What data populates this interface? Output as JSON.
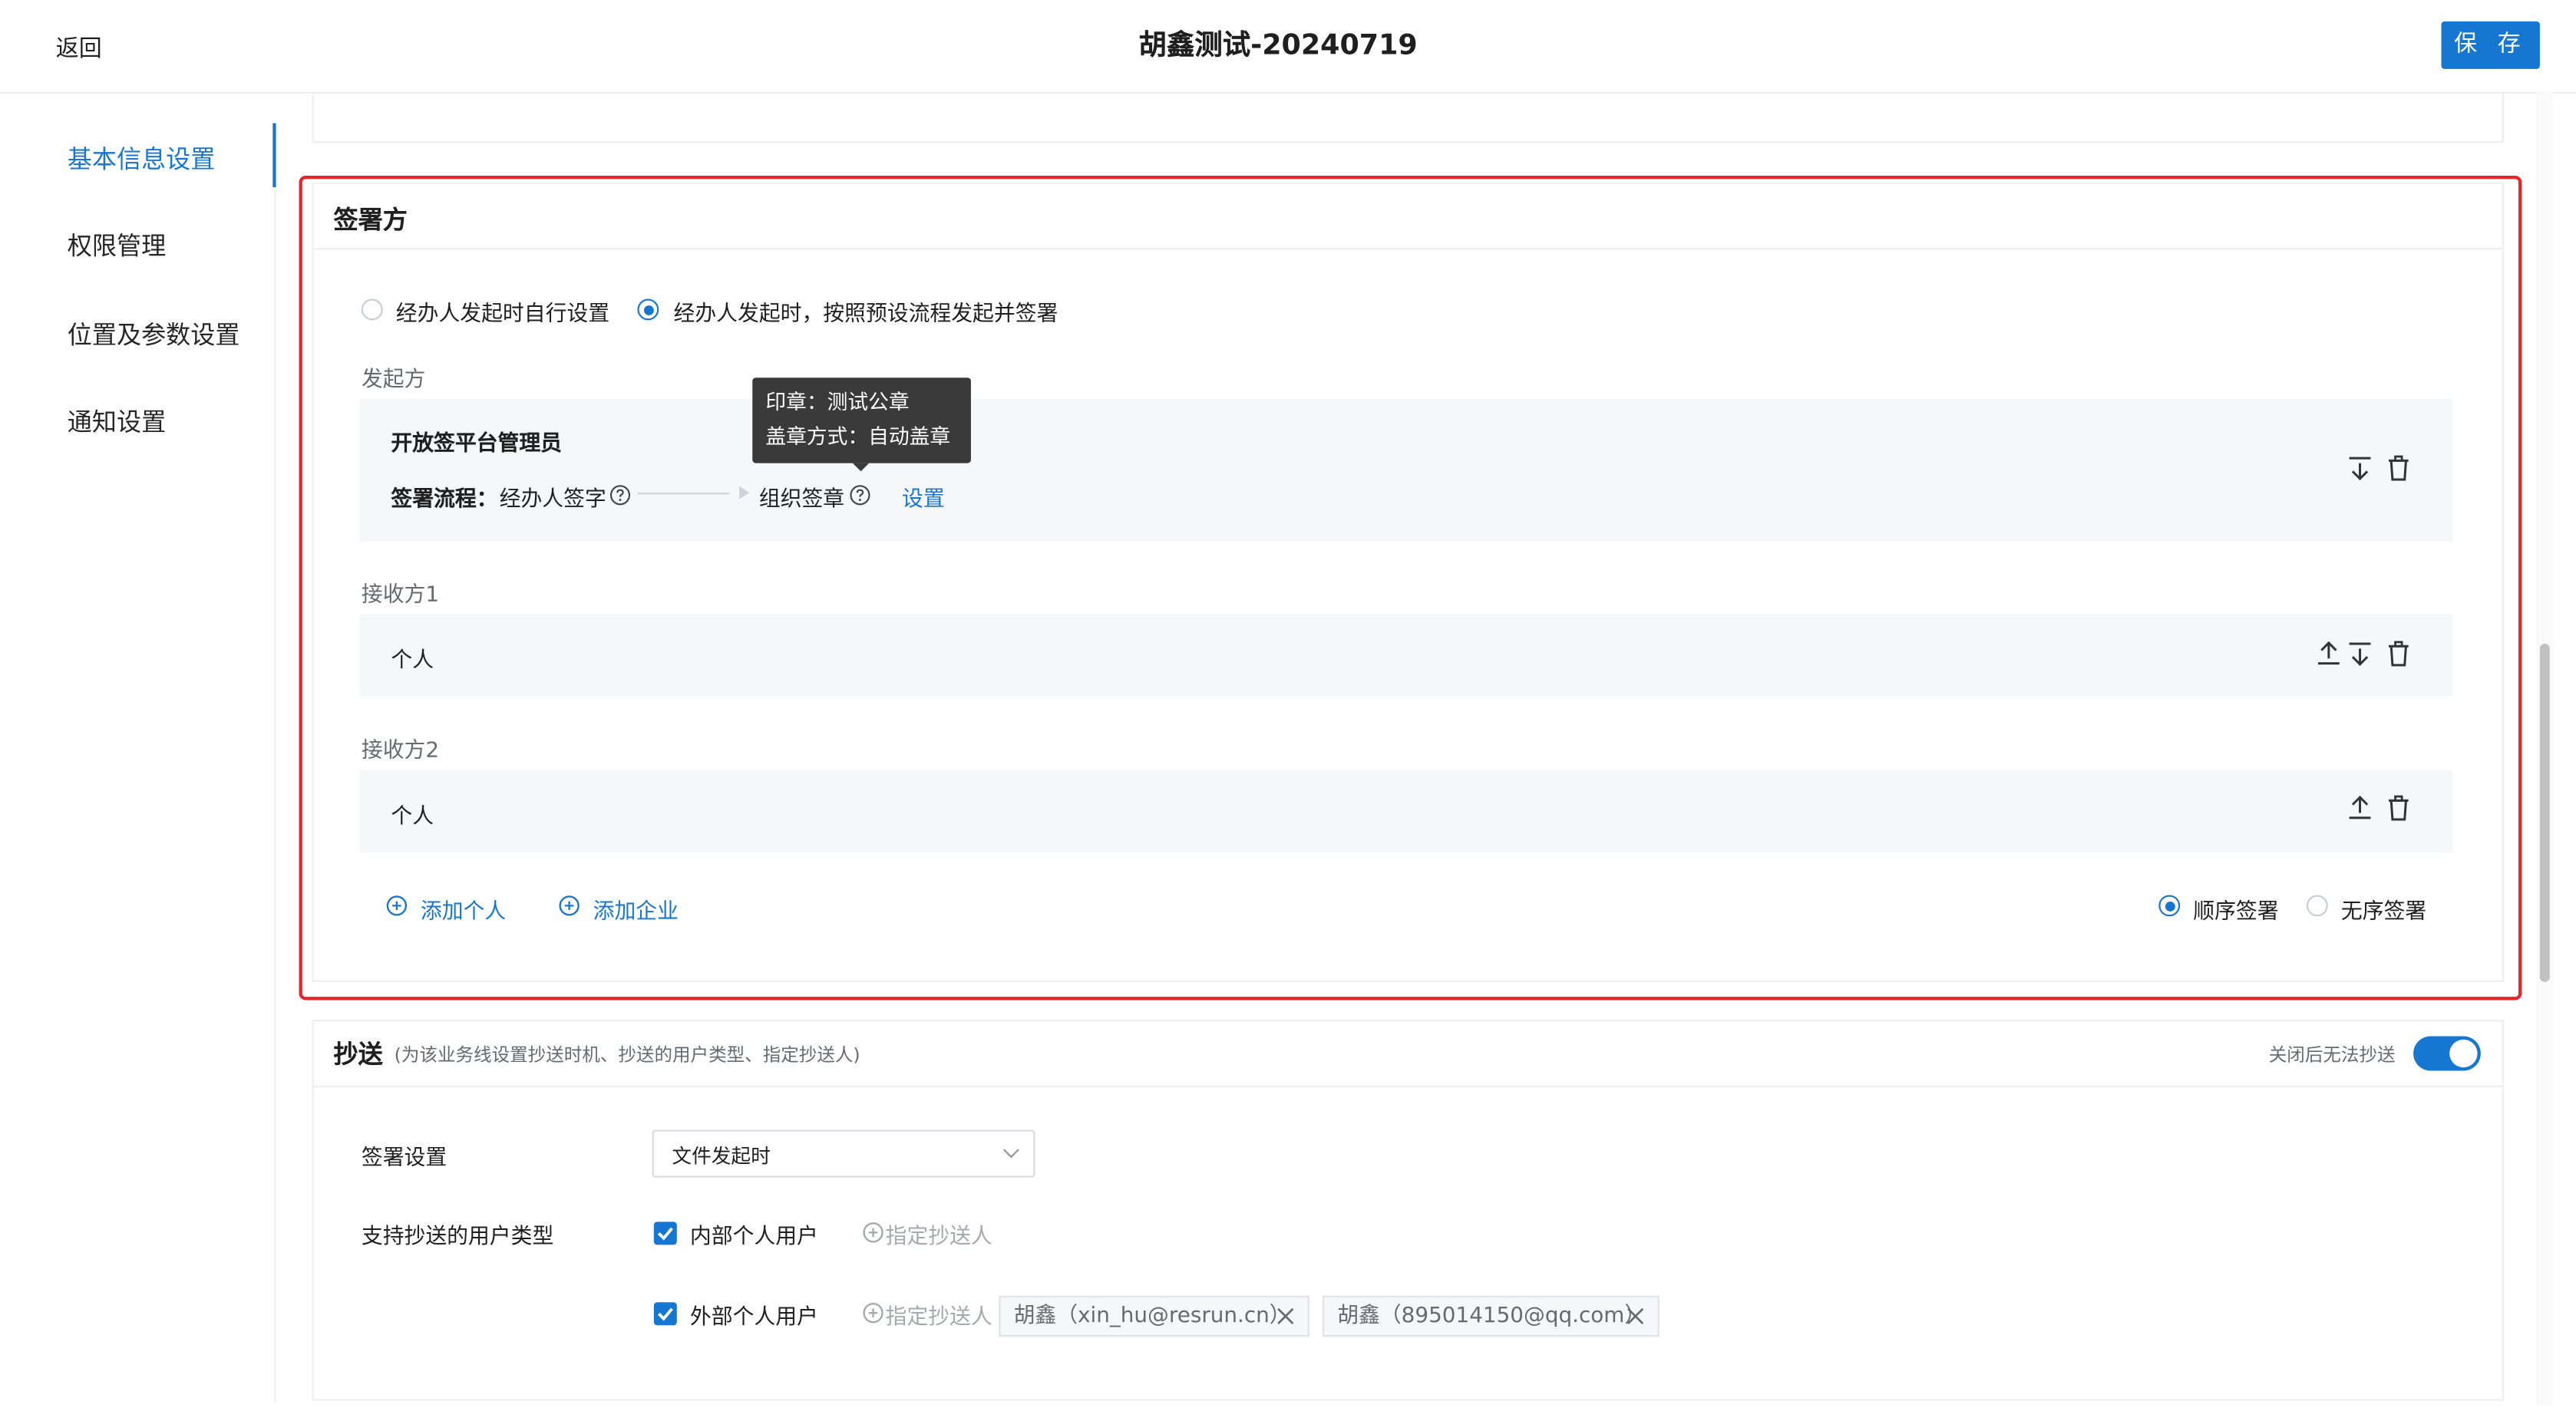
{
  "header": {
    "back_label": "返回",
    "title": "胡鑫测试-20240719",
    "save_label": "保 存"
  },
  "sidebar": {
    "items": [
      {
        "label": "基本信息设置",
        "active": true
      },
      {
        "label": "权限管理",
        "active": false
      },
      {
        "label": "位置及参数设置",
        "active": false
      },
      {
        "label": "通知设置",
        "active": false
      }
    ]
  },
  "signers": {
    "title": "签署方",
    "mode_options": [
      {
        "label": "经办人发起时自行设置",
        "selected": false
      },
      {
        "label": "经办人发起时，按照预设流程发起并签署",
        "selected": true
      }
    ],
    "initiator": {
      "section_label": "发起方",
      "name": "开放签平台管理员",
      "flow_label": "签署流程：",
      "step1": "经办人签字",
      "step2": "组织签章",
      "setting_link": "设置",
      "tooltip_line1": "印章：测试公章",
      "tooltip_line2": "盖章方式：自动盖章"
    },
    "receivers": [
      {
        "section_label": "接收方1",
        "name": "个人"
      },
      {
        "section_label": "接收方2",
        "name": "个人"
      }
    ],
    "add_person": "添加个人",
    "add_company": "添加企业",
    "order_options": [
      {
        "label": "顺序签署",
        "selected": true
      },
      {
        "label": "无序签署",
        "selected": false
      }
    ]
  },
  "cc": {
    "title": "抄送",
    "subtitle": "(为该业务线设置抄送时机、抄送的用户类型、指定抄送人)",
    "toggle_hint": "关闭后无法抄送",
    "toggle_on": true,
    "sign_setting_label": "签署设置",
    "sign_setting_value": "文件发起时",
    "user_type_label": "支持抄送的用户类型",
    "internal": {
      "label": "内部个人用户",
      "checked": true,
      "assign": "指定抄送人"
    },
    "external": {
      "label": "外部个人用户",
      "checked": true,
      "assign": "指定抄送人"
    },
    "recipients": [
      "胡鑫（xin_hu@resrun.cn）",
      "胡鑫（895014150@qq.com）"
    ]
  },
  "colors": {
    "accent": "#1677d2",
    "highlight": "#e4262c"
  },
  "icons": [
    "move-down-icon",
    "move-up-icon",
    "delete-icon",
    "help-icon",
    "add-circle-icon",
    "close-icon",
    "chevron-down-icon"
  ]
}
